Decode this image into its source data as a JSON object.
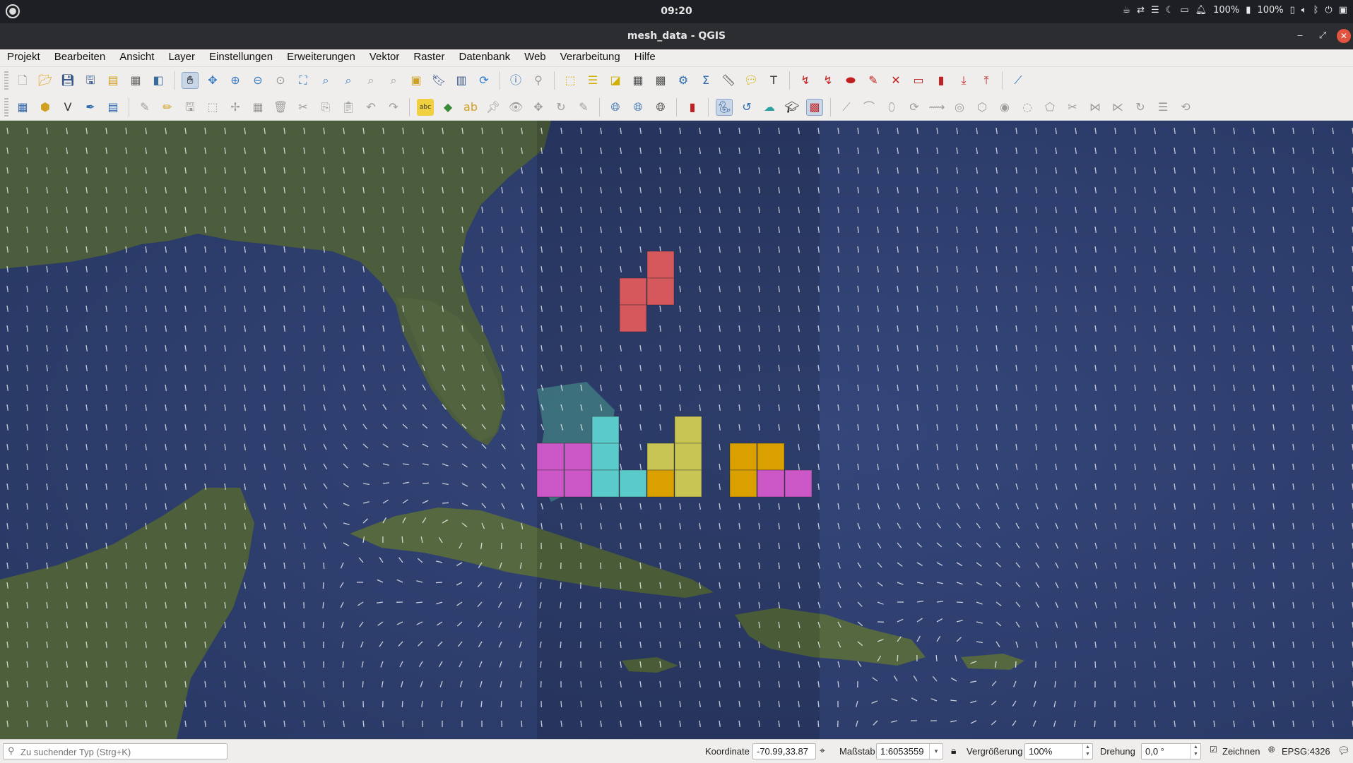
{
  "topbar": {
    "time": "09:20",
    "battery_percent": "100%",
    "battery_percent2": "100%"
  },
  "window": {
    "title": "mesh_data - QGIS",
    "minimize": "‒",
    "maximize": "⤢",
    "close": "✕"
  },
  "menu": [
    "Projekt",
    "Bearbeiten",
    "Ansicht",
    "Layer",
    "Einstellungen",
    "Erweiterungen",
    "Vektor",
    "Raster",
    "Datenbank",
    "Web",
    "Verarbeitung",
    "Hilfe"
  ],
  "status": {
    "search_placeholder": "Zu suchender Typ (Strg+K)",
    "coord_label": "Koordinate",
    "coord_value": "-70.99,33.87",
    "scale_label": "Maßstab",
    "scale_value": "1:6053559",
    "magnifier_label": "Vergrößerung",
    "magnifier_value": "100%",
    "rotation_label": "Drehung",
    "rotation_value": "0,0 °",
    "render_label": "Zeichnen",
    "crs": "EPSG:4326"
  },
  "colors": {
    "ocean": "#2c3c6a",
    "land": "#4a5a3a",
    "arrow": "#ffffff",
    "tetris_red": "#d4585c",
    "tetris_cyan": "#5bcaca",
    "tetris_magenta": "#cc58c8",
    "tetris_olive": "#c9c555",
    "tetris_gold": "#d9a000"
  },
  "icons": {
    "search": "search-icon",
    "lock": "lock-icon",
    "globe": "globe-icon",
    "messages": "messages-icon"
  }
}
